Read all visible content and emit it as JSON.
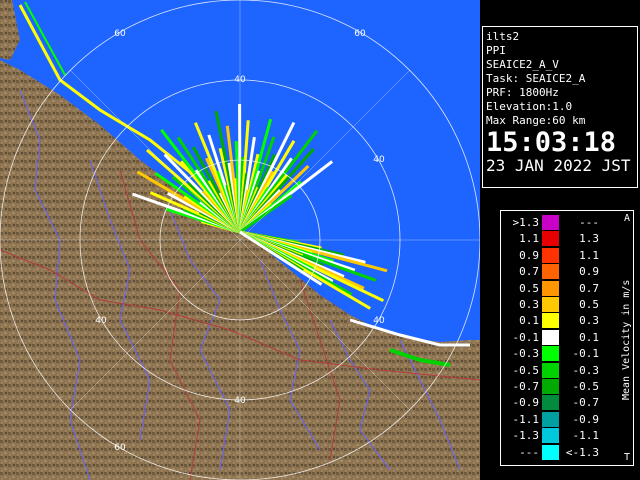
{
  "info": {
    "site": "ilts2",
    "scan_type": "PPI",
    "product": "SEAICE2_A_V",
    "task": "Task: SEAICE2_A",
    "prf": "PRF: 1800Hz",
    "elevation": "Elevation:1.0",
    "max_range": "Max Range:60 km",
    "time": "15:03:18",
    "date": "23 JAN 2022 JST"
  },
  "range_ring_labels": [
    "40",
    "60"
  ],
  "legend": {
    "title": "Mean Velocity in m/s",
    "top_mark": "A",
    "bottom_mark": "T",
    "rows": [
      {
        "left": ">1.3",
        "right": "---",
        "color": "#c800c8"
      },
      {
        "left": "1.1",
        "right": "1.3",
        "color": "#e60000"
      },
      {
        "left": "0.9",
        "right": "1.1",
        "color": "#ff3200"
      },
      {
        "left": "0.7",
        "right": "0.9",
        "color": "#ff6400"
      },
      {
        "left": "0.5",
        "right": "0.7",
        "color": "#ff9600"
      },
      {
        "left": "0.3",
        "right": "0.5",
        "color": "#ffc800"
      },
      {
        "left": "0.1",
        "right": "0.3",
        "color": "#ffff00"
      },
      {
        "left": "-0.1",
        "right": "0.1",
        "color": "#ffffff"
      },
      {
        "left": "-0.3",
        "right": "-0.1",
        "color": "#00ff00"
      },
      {
        "left": "-0.5",
        "right": "-0.3",
        "color": "#00d200"
      },
      {
        "left": "-0.7",
        "right": "-0.5",
        "color": "#00aa00"
      },
      {
        "left": "-0.9",
        "right": "-0.7",
        "color": "#008c3c"
      },
      {
        "left": "-1.1",
        "right": "-0.9",
        "color": "#00a0a0"
      },
      {
        "left": "-1.3",
        "right": "-1.1",
        "color": "#00c8dc"
      },
      {
        "left": "---",
        "right": "<-1.3",
        "color": "#00ffff"
      }
    ]
  },
  "colors": {
    "sea": "#1e64ff",
    "land": "#8c7352",
    "land_dark": "#5a4a32",
    "river": "#6464ff",
    "border": "#b43c3c",
    "ring": "#ffffff"
  }
}
